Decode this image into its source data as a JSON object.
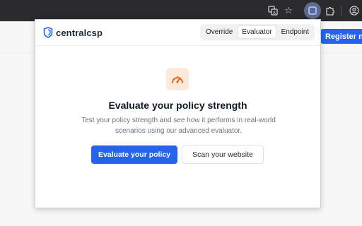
{
  "browser": {
    "icons": {
      "translate": "translate-icon",
      "bookmark": "star-icon",
      "extension_active": "extension-icon",
      "extensions": "puzzle-icon",
      "profile": "profile-icon"
    }
  },
  "page": {
    "register_label": "Register now"
  },
  "popup": {
    "logo_text": "centralcsp",
    "tabs": [
      {
        "label": "Override",
        "active": false
      },
      {
        "label": "Evaluator",
        "active": true
      },
      {
        "label": "Endpoint",
        "active": false
      }
    ],
    "hero": {
      "icon": "gauge-icon",
      "title": "Evaluate your policy strength",
      "description": "Test your policy strength and see how it performs in real-world scenarios using our advanced evaluator."
    },
    "primary_button": "Evaluate your policy",
    "secondary_button": "Scan your website"
  },
  "colors": {
    "accent": "#2563eb",
    "icon_orange": "#ea6a1f",
    "icon_bg": "#fbe9da"
  }
}
